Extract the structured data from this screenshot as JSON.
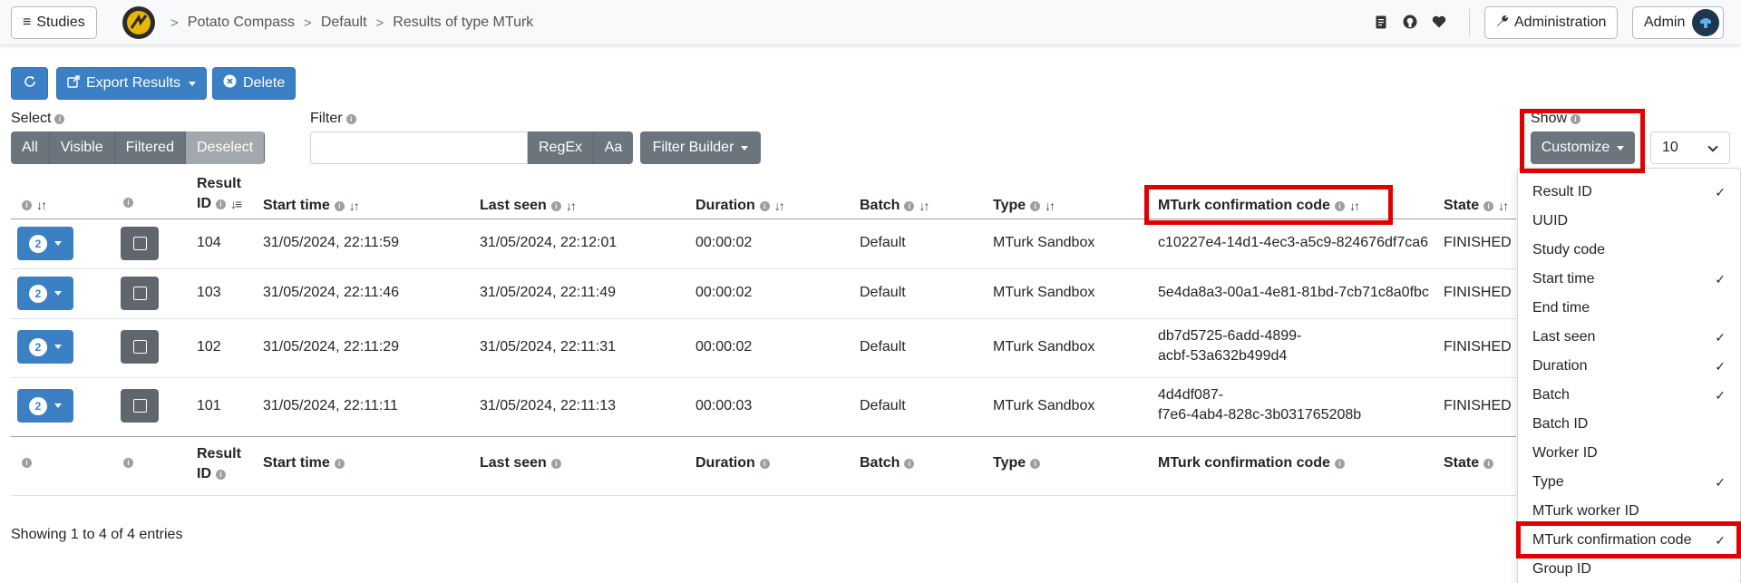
{
  "navbar": {
    "studies_label": "Studies",
    "breadcrumbs": [
      "Potato Compass",
      "Default",
      "Results of type MTurk"
    ],
    "administration_label": "Administration",
    "user_label": "Admin"
  },
  "toolbar": {
    "export_label": "Export Results",
    "delete_label": "Delete"
  },
  "select": {
    "label": "Select",
    "options": [
      "All",
      "Visible",
      "Filtered",
      "Deselect"
    ]
  },
  "filter": {
    "label": "Filter",
    "value": "",
    "regex_label": "RegEx",
    "case_label": "Aa",
    "builder_label": "Filter Builder"
  },
  "show": {
    "label": "Show",
    "customize_label": "Customize",
    "page_length": "10"
  },
  "table": {
    "headers": {
      "result_id_1": "Result",
      "result_id_2": "ID",
      "start_time": "Start time",
      "last_seen": "Last seen",
      "duration": "Duration",
      "batch": "Batch",
      "type": "Type",
      "confirmation": "MTurk confirmation code",
      "state": "State"
    },
    "rows": [
      {
        "badge": "2",
        "id": "104",
        "start": "31/05/2024, 22:11:59",
        "last": "31/05/2024, 22:12:01",
        "duration": "00:00:02",
        "batch": "Default",
        "type": "MTurk Sandbox",
        "code1": "c10227e4-14d1-4ec3-a5c9-824676df7ca6",
        "code2": "",
        "state": "FINISHED"
      },
      {
        "badge": "2",
        "id": "103",
        "start": "31/05/2024, 22:11:46",
        "last": "31/05/2024, 22:11:49",
        "duration": "00:00:02",
        "batch": "Default",
        "type": "MTurk Sandbox",
        "code1": "5e4da8a3-00a1-4e81-81bd-7cb71c8a0fbc",
        "code2": "",
        "state": "FINISHED"
      },
      {
        "badge": "2",
        "id": "102",
        "start": "31/05/2024, 22:11:29",
        "last": "31/05/2024, 22:11:31",
        "duration": "00:00:02",
        "batch": "Default",
        "type": "MTurk Sandbox",
        "code1": "db7d5725-6add-4899-",
        "code2": "acbf-53a632b499d4",
        "state": "FINISHED"
      },
      {
        "badge": "2",
        "id": "101",
        "start": "31/05/2024, 22:11:11",
        "last": "31/05/2024, 22:11:13",
        "duration": "00:00:03",
        "batch": "Default",
        "type": "MTurk Sandbox",
        "code1": "4d4df087-",
        "code2": "f7e6-4ab4-828c-3b031765208b",
        "state": "FINISHED"
      }
    ],
    "footer_info": "Showing 1 to 4 of 4 entries"
  },
  "customize_menu": {
    "items": [
      {
        "label": "Result ID",
        "checked": "✓"
      },
      {
        "label": "UUID",
        "checked": ""
      },
      {
        "label": "Study code",
        "checked": ""
      },
      {
        "label": "Start time",
        "checked": "✓"
      },
      {
        "label": "End time",
        "checked": ""
      },
      {
        "label": "Last seen",
        "checked": "✓"
      },
      {
        "label": "Duration",
        "checked": "✓"
      },
      {
        "label": "Batch",
        "checked": "✓"
      },
      {
        "label": "Batch ID",
        "checked": ""
      },
      {
        "label": "Worker ID",
        "checked": ""
      },
      {
        "label": "Type",
        "checked": "✓"
      },
      {
        "label": "MTurk worker ID",
        "checked": ""
      },
      {
        "label": "MTurk confirmation code",
        "checked": "✓"
      },
      {
        "label": "Group ID",
        "checked": ""
      }
    ]
  },
  "colors": {
    "primary": "#3b7fc4",
    "secondary": "#6c757d",
    "highlight": "#e00000"
  }
}
